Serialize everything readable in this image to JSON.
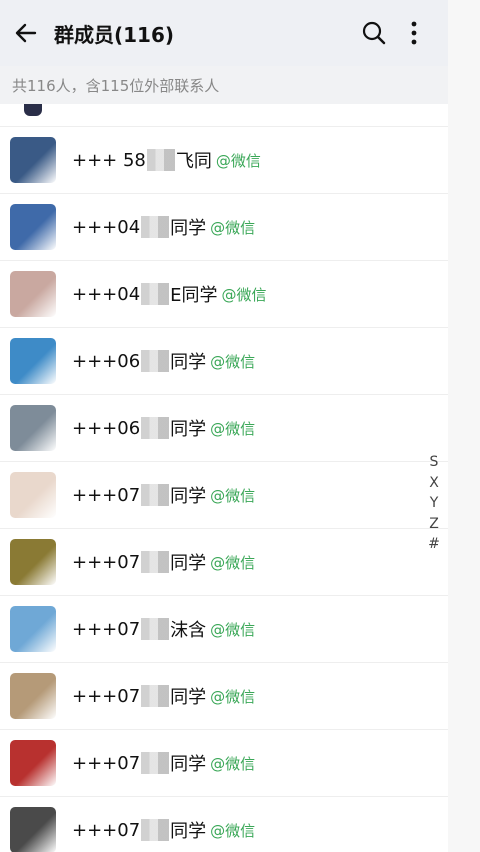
{
  "header": {
    "title": "群成员(116)",
    "icons": {
      "back": "arrow-left-icon",
      "search": "search-icon",
      "more": "more-vertical-icon"
    }
  },
  "summary": "共116人，含115位外部联系人",
  "members": [
    {
      "prefix": "+++ 58",
      "suffix": "飞同",
      "tag": "@微信",
      "avatar_color": "#3a5a86"
    },
    {
      "prefix": "+++04",
      "suffix": "同学",
      "tag": "@微信",
      "avatar_color": "#3f6aa9"
    },
    {
      "prefix": "+++04",
      "suffix": "E同学",
      "tag": "@微信",
      "avatar_color": "#c9a8a0"
    },
    {
      "prefix": "+++06",
      "suffix": "同学",
      "tag": "@微信",
      "avatar_color": "#3e8bc7"
    },
    {
      "prefix": "+++06",
      "suffix": "同学",
      "tag": "@微信",
      "avatar_color": "#7e8c99"
    },
    {
      "prefix": "+++07",
      "suffix": "同学",
      "tag": "@微信",
      "avatar_color": "#e9d8cc"
    },
    {
      "prefix": "+++07",
      "suffix": "同学",
      "tag": "@微信",
      "avatar_color": "#8a7a34"
    },
    {
      "prefix": "+++07",
      "suffix": "沫含",
      "tag": "@微信",
      "avatar_color": "#6fa8d6"
    },
    {
      "prefix": "+++07",
      "suffix": "同学",
      "tag": "@微信",
      "avatar_color": "#b59a78"
    },
    {
      "prefix": "+++07",
      "suffix": "同学",
      "tag": "@微信",
      "avatar_color": "#b8312f"
    },
    {
      "prefix": "+++07",
      "suffix": "同学",
      "tag": "@微信",
      "avatar_color": "#4a4a4a"
    }
  ],
  "index_letters": [
    "S",
    "X",
    "Y",
    "Z",
    "#"
  ],
  "colors": {
    "header_bg": "#eef0f4",
    "tag": "#3aa757",
    "summary_text": "#888888"
  }
}
